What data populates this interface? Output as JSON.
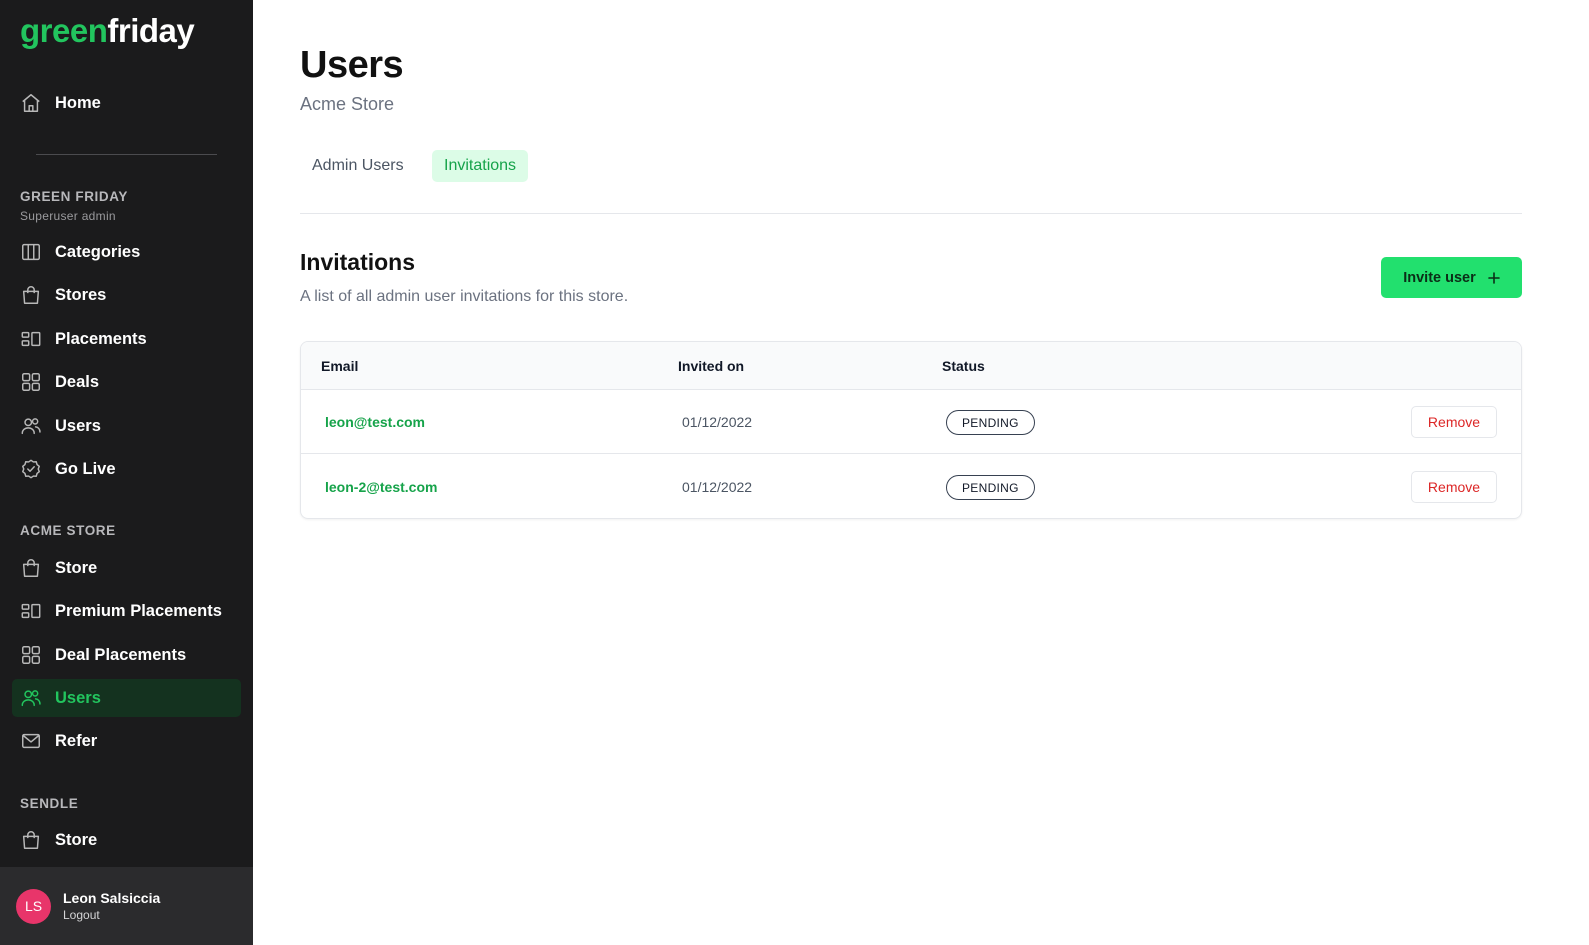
{
  "brand": {
    "part1": "green",
    "part2": "friday",
    "accent": "#22c55e"
  },
  "sidebar": {
    "home": {
      "label": "Home",
      "icon": "home-icon"
    },
    "groups": [
      {
        "title": "GREEN FRIDAY",
        "subtitle": "Superuser admin",
        "items": [
          {
            "label": "Categories",
            "icon": "columns-icon"
          },
          {
            "label": "Stores",
            "icon": "shopping-bag-icon"
          },
          {
            "label": "Placements",
            "icon": "placements-icon"
          },
          {
            "label": "Deals",
            "icon": "grid-icon"
          },
          {
            "label": "Users",
            "icon": "users-icon"
          },
          {
            "label": "Go Live",
            "icon": "check-badge-icon"
          }
        ]
      },
      {
        "title": "ACME STORE",
        "items": [
          {
            "label": "Store",
            "icon": "shopping-bag-icon"
          },
          {
            "label": "Premium Placements",
            "icon": "placements-icon"
          },
          {
            "label": "Deal Placements",
            "icon": "grid-icon"
          },
          {
            "label": "Users",
            "icon": "users-icon",
            "active": true
          },
          {
            "label": "Refer",
            "icon": "mail-icon"
          }
        ]
      },
      {
        "title": "SENDLE",
        "items": [
          {
            "label": "Store",
            "icon": "shopping-bag-icon"
          }
        ]
      }
    ],
    "user": {
      "initials": "LS",
      "name": "Leon Salsiccia",
      "logout": "Logout",
      "avatar_color": "#e8356a"
    }
  },
  "header": {
    "title": "Users",
    "subtitle": "Acme Store"
  },
  "tabs": [
    {
      "label": "Admin Users",
      "active": false
    },
    {
      "label": "Invitations",
      "active": true
    }
  ],
  "invitations": {
    "heading": "Invitations",
    "description": "A list of all admin user invitations for this store.",
    "invite_button": "Invite user",
    "invite_icon": "plus-icon",
    "columns": [
      "Email",
      "Invited on",
      "Status"
    ],
    "rows": [
      {
        "email": "leon@test.com",
        "invited_on": "01/12/2022",
        "status": "PENDING",
        "action": "Remove"
      },
      {
        "email": "leon-2@test.com",
        "invited_on": "01/12/2022",
        "status": "PENDING",
        "action": "Remove"
      }
    ]
  }
}
